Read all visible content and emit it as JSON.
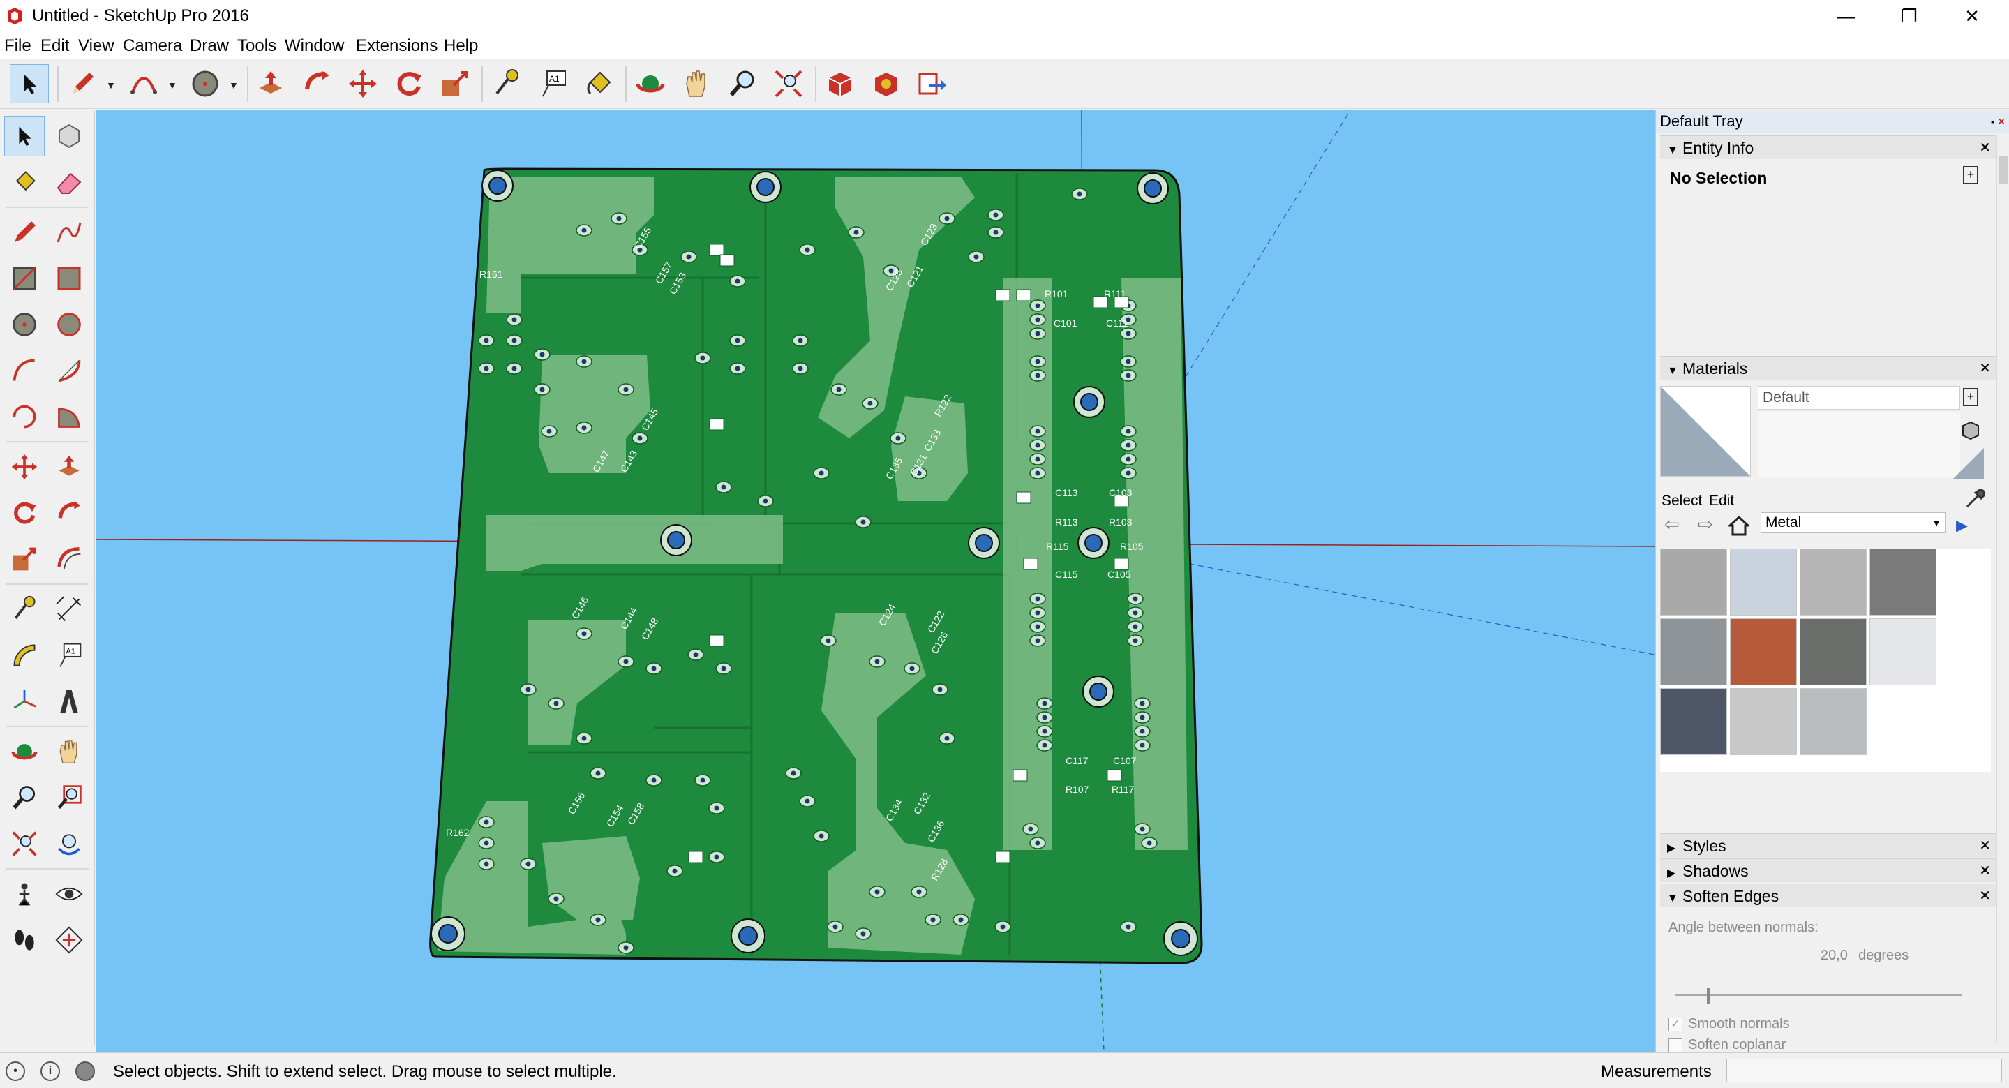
{
  "window": {
    "title": "Untitled - SketchUp Pro 2016",
    "minimize": "—",
    "restore": "❐",
    "close": "✕"
  },
  "menu": [
    "File",
    "Edit",
    "View",
    "Camera",
    "Draw",
    "Tools",
    "Window",
    "Extensions",
    "Help"
  ],
  "toolbar_icons": [
    "select-icon",
    "pencil-icon",
    "arc-icon",
    "circle-icon",
    "push-pull-icon",
    "follow-me-icon",
    "move-icon",
    "rotate-icon",
    "scale-icon",
    "tape-measure-icon",
    "text-icon",
    "paint-bucket-icon",
    "orbit-icon",
    "pan-icon",
    "zoom-icon",
    "zoom-extents-icon",
    "warehouse-icon",
    "extension-warehouse-icon",
    "send-to-layout-icon"
  ],
  "left_toolbar_icons": [
    "select-icon",
    "component-icon",
    "paint-bucket-icon",
    "eraser-icon",
    "line-icon",
    "freehand-icon",
    "rectangle-icon",
    "rotated-rectangle-icon",
    "circle-icon",
    "polygon-icon",
    "arc-icon",
    "arc-2pt-icon",
    "arc-3pt-icon",
    "pie-icon",
    "move-icon",
    "push-pull-icon",
    "rotate-icon",
    "follow-me-icon",
    "scale-icon",
    "offset-icon",
    "tape-measure-icon",
    "dimension-icon",
    "protractor-icon",
    "text-icon",
    "axes-icon",
    "3d-text-icon",
    "orbit-icon",
    "pan-icon",
    "zoom-icon",
    "zoom-window-icon",
    "zoom-extents-icon",
    "previous-view-icon",
    "position-camera-icon",
    "look-around-icon",
    "walk-icon",
    "section-plane-icon"
  ],
  "board": {
    "labels": [
      "C155",
      "R161",
      "C157",
      "C153",
      "C123",
      "C125",
      "C121",
      "R101",
      "C101",
      "R111",
      "C111",
      "C145",
      "C147",
      "C143",
      "R122",
      "C133",
      "C135",
      "C131",
      "C113",
      "R113",
      "C103",
      "R103",
      "R115",
      "C115",
      "R105",
      "C105",
      "C146",
      "C144",
      "C148",
      "C124",
      "C122",
      "C126",
      "C117",
      "R107",
      "C107",
      "R117",
      "C156",
      "C154",
      "C158",
      "C134",
      "C132",
      "C136",
      "R128",
      "R162"
    ]
  },
  "tray": {
    "title": "Default Tray",
    "entity_info": {
      "header": "Entity Info",
      "selection": "No Selection"
    },
    "materials": {
      "header": "Materials",
      "current_name": "Default",
      "tab_select": "Select",
      "tab_edit": "Edit",
      "library": "Metal",
      "swatches": [
        "#a9a9a9",
        "#c9d3dd",
        "#b5b5b5",
        "#7a7a7a",
        "#8f9499",
        "#b65a3c",
        "#6b6d6b",
        "#e4e6ea",
        "#4e5768",
        "#c8c8c8",
        "#b9bcbf"
      ]
    },
    "styles": {
      "header": "Styles"
    },
    "shadows": {
      "header": "Shadows"
    },
    "soften": {
      "header": "Soften Edges",
      "angle_label": "Angle between normals:",
      "angle_value": "20,0",
      "angle_unit": "degrees",
      "angle_fraction": 0.11,
      "smooth_normals": "Smooth normals",
      "soften_coplanar": "Soften coplanar"
    }
  },
  "status": {
    "message": "Select objects. Shift to extend select. Drag mouse to select multiple.",
    "measurements_label": "Measurements",
    "measurements_value": ""
  },
  "colors": {
    "sky": "#76c4f5",
    "pcb": "#1e8a3e",
    "pcb_edge": "#1a1a1a",
    "silk": "#ffffff",
    "pad": "#cfe7d2"
  }
}
